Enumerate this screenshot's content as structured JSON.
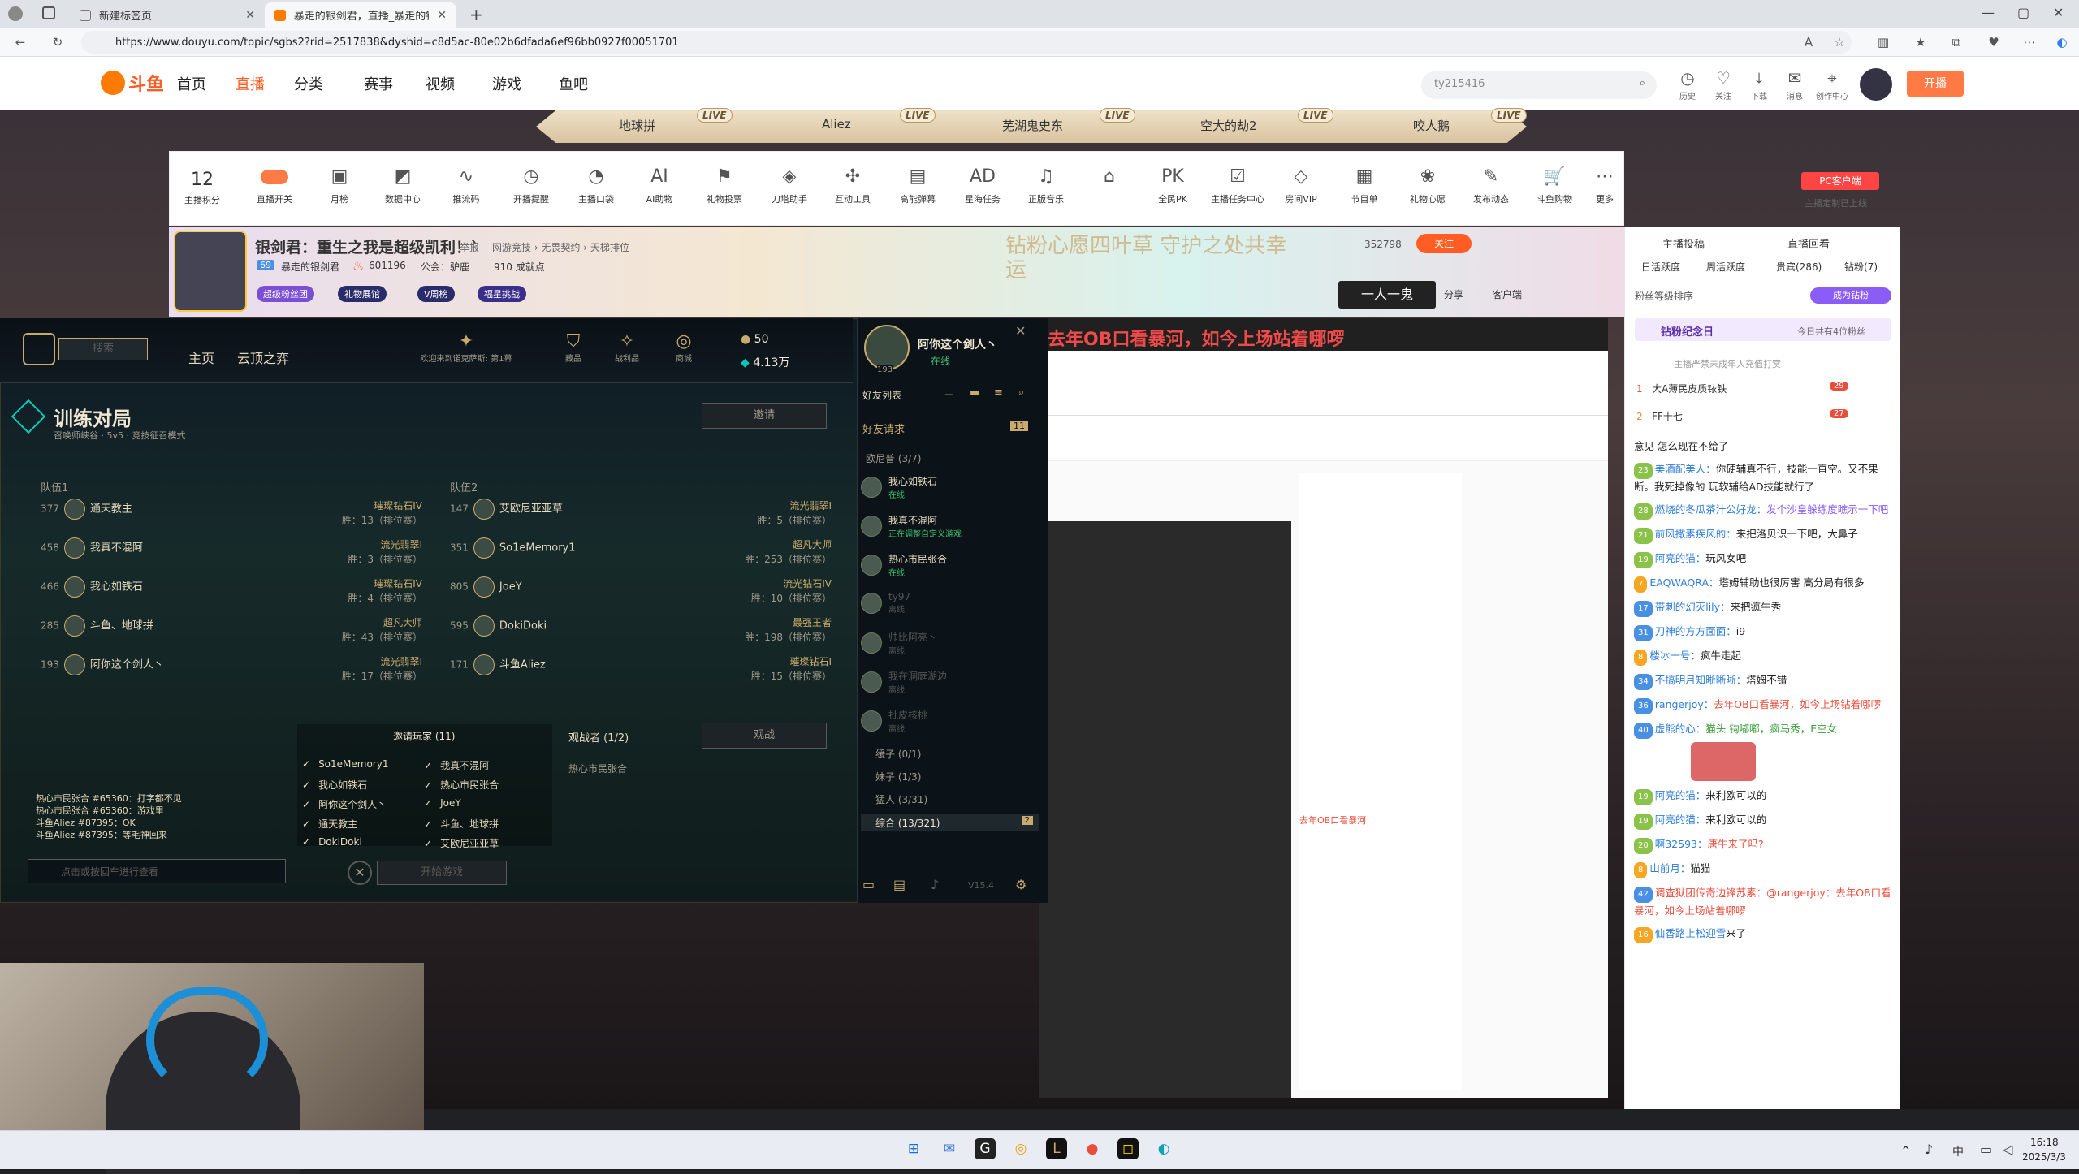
{
  "browser": {
    "tabs": [
      {
        "label": "新建标签页"
      },
      {
        "label": "暴走的银剑君，直播_暴走的银剑..."
      }
    ],
    "url": "https://www.douyu.com/topic/sgbs2?rid=2517838&dyshid=c8d5ac-80e02b6dfada6ef96bb0927f00051701"
  },
  "header": {
    "logo": "斗鱼",
    "nav": [
      "首页",
      "直播",
      "分类",
      "赛事",
      "视频",
      "游戏",
      "鱼吧"
    ],
    "search_placeholder": "ty215416",
    "icons": [
      {
        "icon": "history-icon",
        "label": "历史"
      },
      {
        "label": "关注",
        "icon": "heart-icon"
      },
      {
        "label": "下载",
        "icon": "download-icon"
      },
      {
        "label": "消息",
        "icon": "bell-icon"
      },
      {
        "label": "创作中心",
        "icon": "location-icon"
      }
    ],
    "open_live": "开播"
  },
  "categories": [
    "地球拼",
    "Aliez",
    "芜湖鬼史东",
    "空大的劫2",
    "咬人鹅"
  ],
  "live_tag": "LIVE",
  "toolbar": {
    "score": "12",
    "score_label": "主播积分",
    "items": [
      "直播开关",
      "月榜",
      "数据中心",
      "推流码",
      "开播提醒",
      "主播口袋",
      "AI助物",
      "礼物投票",
      "刀塔助手",
      "互动工具",
      "高能弹幕",
      "星海任务",
      "正版音乐",
      "",
      "全民PK",
      "主播任务中心",
      "房间VIP",
      "节目单",
      "礼物心愿",
      "发布动态",
      "斗鱼购物",
      "更多"
    ],
    "pc_client": "PC客户端",
    "pc_sub": "主播定制已上线"
  },
  "room": {
    "title": "银剑君：重生之我是超级凯利！`",
    "tag1": "举报",
    "category": "网游竞技 › 无畏契约 › 天梯排位",
    "anchor": "暴走的银剑君",
    "heat": "601196",
    "union": "公会：驴鹿",
    "fans": "910 成就点",
    "level": "69",
    "badges": [
      "超级粉丝团",
      "礼物展馆",
      "V周榜",
      "福星挑战"
    ],
    "follow_count": "352798",
    "follow_label": "关注",
    "share": "分享",
    "client": "客户端",
    "event_banner": "钻粉心愿四叶草 守护之处共幸运"
  },
  "right_panel": {
    "top_tabs": [
      "主播投稿",
      "直播回看"
    ],
    "tabs": [
      "日活跃度",
      "周活跃度",
      "贵宾(286)",
      "钻粉(7)"
    ],
    "rank_label": "粉丝等级排序",
    "become_diamond": "成为钻粉",
    "anniv": "钻粉纪念日",
    "anniv_sub": "今日共有4位粉丝",
    "notice": "主播严禁未成年人充值打赏",
    "top": [
      {
        "rank": "1",
        "name": "大A薄民皮质铱铁",
        "badge": "29"
      },
      {
        "rank": "2",
        "name": "FF十七",
        "badge": "27"
      }
    ],
    "chat": [
      {
        "lv": "",
        "name": "",
        "text": "意见 怎么现在不给了"
      },
      {
        "lv": "23",
        "name": "美酒配美人：",
        "text": "你硬辅真不行，技能一直空。又不果断。我死掉像的 玩软辅给AD技能就行了"
      },
      {
        "lv": "28",
        "name": "燃烧的冬瓜茶汁公好龙：",
        "text": "发个沙皇躲练度瞧示一下吧"
      },
      {
        "lv": "21",
        "name": "前风撒素疾风的：",
        "text": "来把洛贝识一下吧，大鼻子"
      },
      {
        "lv": "19",
        "name": "阿亮的猫：",
        "text": "玩风女吧"
      },
      {
        "lv": "7",
        "name": "EAQWAQRA：",
        "text": "塔姆辅助也很厉害 高分局有很多"
      },
      {
        "lv": "17",
        "name": "带刺的幻灭lily：",
        "text": "来把疯牛秀"
      },
      {
        "lv": "31",
        "name": "刀神的方方面面：",
        "text": "i9"
      },
      {
        "lv": "8",
        "name": "楼冰一号：",
        "text": "疯牛走起"
      },
      {
        "lv": "34",
        "name": "不搞明月知晰晰晰：",
        "text": "塔姆不错"
      },
      {
        "lv": "36",
        "name": "rangerjoy：",
        "text": "去年OB口看暴河，如今上场钻着哪啰"
      },
      {
        "lv": "40",
        "name": "虚熊的心：",
        "text": "猫头 钩嘟嘟，疯马秀，E空女"
      },
      {
        "lv": "19",
        "name": "阿亮的猫：",
        "text": "来利欧可以的"
      },
      {
        "lv": "19",
        "name": "阿亮的猫：",
        "text": "来利欧可以的"
      },
      {
        "lv": "20",
        "name": "啊32593：",
        "text": "唐牛来了吗?"
      },
      {
        "lv": "8",
        "name": "山前月：",
        "text": "猫猫"
      },
      {
        "lv": "42",
        "name": "调查狱团传奇边锋苏素：",
        "text": "@rangerjoy：去年OB口看暴河，如今上场站着哪啰"
      },
      {
        "lv": "16",
        "name": "仙香路上松迎雪",
        "text": "来了"
      }
    ]
  },
  "lol": {
    "search": "搜索",
    "nav": [
      "主页",
      "云顶之弈"
    ],
    "welcome": "欢迎来到诺克萨斯: 第1幕",
    "icons": [
      {
        "label": "藏品",
        "icon": "collection-icon"
      },
      {
        "label": "战利品",
        "icon": "loot-icon"
      },
      {
        "label": "商城",
        "icon": "store-icon"
      }
    ],
    "currency": {
      "rp": "50",
      "be": "4.13万"
    },
    "user": {
      "name": "阿你这个剑人丶",
      "status": "在线",
      "level": "193"
    },
    "lobby_title": "训练对局",
    "lobby_sub": "召唤师峡谷 · 5v5 · 竞技征召模式",
    "invite_btn": "邀请",
    "team1_label": "队伍1",
    "team2_label": "队伍2",
    "team1": [
      {
        "num": "377",
        "name": "通天教主",
        "rank": "璀璨钻石IV",
        "rank_line": "胜：13（排位赛）"
      },
      {
        "num": "458",
        "name": "我真不混阿",
        "rank": "流光翡翠I",
        "rank_line": "胜：3（排位赛）"
      },
      {
        "num": "466",
        "name": "我心如铁石",
        "rank": "璀璨钻石IV",
        "rank_line": "胜：4（排位赛）"
      },
      {
        "num": "285",
        "name": "斗鱼、地球拼",
        "rank": "超凡大师",
        "rank_line": "胜：43（排位赛）"
      },
      {
        "num": "193",
        "name": "阿你这个剑人丶",
        "rank": "流光翡翠I",
        "rank_line": "胜：17（排位赛）"
      }
    ],
    "team2": [
      {
        "num": "147",
        "name": "艾欧尼亚亚草",
        "rank": "流光翡翠I",
        "rank_line": "胜：5（排位赛）"
      },
      {
        "num": "351",
        "name": "So1eMemory1",
        "rank": "超凡大师",
        "rank_line": "胜：253（排位赛）"
      },
      {
        "num": "805",
        "name": "JoeY",
        "rank": "流光钻石IV",
        "rank_line": "胜：10（排位赛）"
      },
      {
        "num": "595",
        "name": "DokiDoki",
        "rank": "最强王者",
        "rank_line": "胜：198（排位赛）"
      },
      {
        "num": "171",
        "name": "斗鱼Aliez",
        "rank": "璀璨钻石I",
        "rank_line": "胜：15（排位赛）"
      }
    ],
    "invite_title": "邀请玩家 (11)",
    "invitees": [
      "So1eMemory1",
      "我真不混阿",
      "我心如铁石",
      "热心市民张合",
      "阿你这个剑人丶",
      "JoeY",
      "通天教主",
      "斗鱼、地球拼",
      "DokiDoki",
      "艾欧尼亚亚草"
    ],
    "spectators_title": "观战者 (1/2)",
    "spectator": "热心市民张合",
    "spectate_btn": "观战",
    "start_btn": "开始游戏",
    "chat_lines": [
      "热心市民张合 #65360：打字都不见",
      "热心市民张合 #65360：游戏里",
      "斗鱼Aliez #87395：OK",
      "斗鱼Aliez #87395：等毛神回来"
    ],
    "chat_placeholder": "点击或按回车进行查看",
    "friends_title": "好友列表",
    "friend_req": "好友请求",
    "friend_req_count": "11",
    "group_ionia": "欧尼普 (3/7)",
    "friends": [
      {
        "name": "我心如铁石",
        "status": "在线",
        "on": true
      },
      {
        "name": "我真不混阿",
        "status": "正在调整自定义游戏",
        "on": true
      },
      {
        "name": "热心市民张合",
        "status": "在线",
        "on": true
      },
      {
        "name": "ty97",
        "status": "离线",
        "on": false
      },
      {
        "name": "帅比阿亮丶",
        "status": "离线",
        "on": false
      },
      {
        "name": "我在洞庭湖边",
        "status": "离线",
        "on": false
      },
      {
        "name": "批皮核桃",
        "status": "离线",
        "on": false
      }
    ],
    "groups": [
      "缓子 (0/1)",
      "妹子 (1/3)",
      "猛人 (3/31)",
      "综合 (13/321)"
    ],
    "groups_count": "2",
    "version": "V15.4"
  },
  "overlay_title": "去年OB口看暴河，如今上场站着哪啰",
  "preview_overlay": "去年OB口看暴河",
  "taskbar": {
    "time": "16:18",
    "date": "2025/3/3",
    "ime": "中"
  }
}
